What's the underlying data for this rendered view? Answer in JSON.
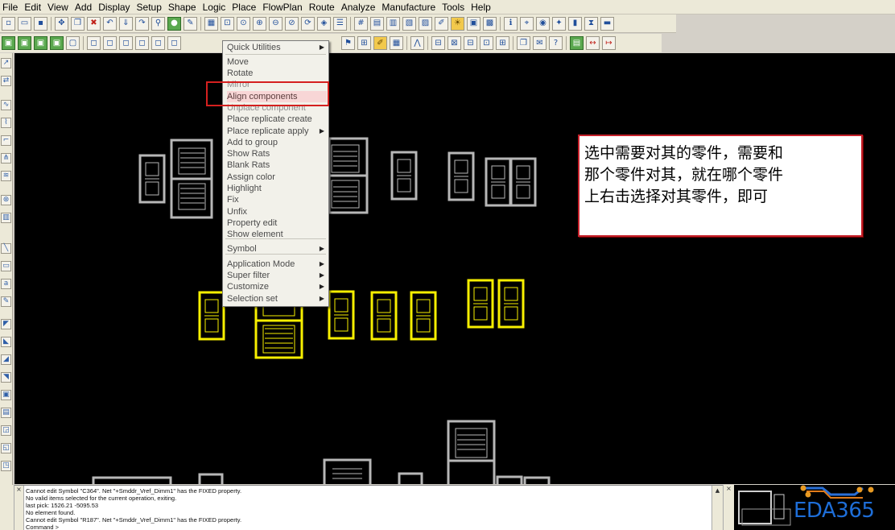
{
  "menu": [
    "File",
    "Edit",
    "View",
    "Add",
    "Display",
    "Setup",
    "Shape",
    "Logic",
    "Place",
    "FlowPlan",
    "Route",
    "Analyze",
    "Manufacture",
    "Tools",
    "Help"
  ],
  "context_menu": {
    "items": [
      {
        "label": "Quick Utilities",
        "submenu": true
      },
      {
        "label": "Move"
      },
      {
        "label": "Rotate"
      },
      {
        "label": "Mirror"
      },
      {
        "label": "Align components"
      },
      {
        "label": "Unplace component"
      },
      {
        "label": "Place replicate create"
      },
      {
        "label": "Place replicate apply",
        "submenu": true
      },
      {
        "label": "Add to group"
      },
      {
        "label": "Show Rats"
      },
      {
        "label": "Blank Rats"
      },
      {
        "label": "Assign color"
      },
      {
        "label": "Highlight"
      },
      {
        "label": "Fix"
      },
      {
        "label": "Unfix"
      },
      {
        "label": "Property edit"
      },
      {
        "label": "Show element"
      },
      {
        "label": "Symbol",
        "submenu": true
      },
      {
        "label": "Application Mode",
        "submenu": true
      },
      {
        "label": "Super filter",
        "submenu": true
      },
      {
        "label": "Customize",
        "submenu": true
      },
      {
        "label": "Selection set",
        "submenu": true
      }
    ],
    "highlighted_item": "Align components"
  },
  "annotation": {
    "lines": [
      "选中需要对其的零件，需要和",
      "那个零件对其，就在哪个零件",
      "上右击选择对其零件，即可"
    ]
  },
  "console": {
    "lines": [
      "Cannot edit Symbol \"C364\". Net \"+Smddr_Vref_Dimm1\" has the FIXED property.",
      "No valid items selected for the current operation, exiting.",
      "last pick:  1526.21  -5095.53",
      "No element found.",
      "Cannot edit Symbol \"R187\". Net \"+Smddr_Vref_Dimm1\" has the FIXED property.",
      "Command >"
    ]
  },
  "watermark": "EDA365",
  "colors": {
    "canvas": "#000000",
    "component_outline": "#b7b7b7",
    "selected_component": "#f7ef00",
    "highlight_border": "#d5201f",
    "annotation_border": "#c5202a"
  }
}
